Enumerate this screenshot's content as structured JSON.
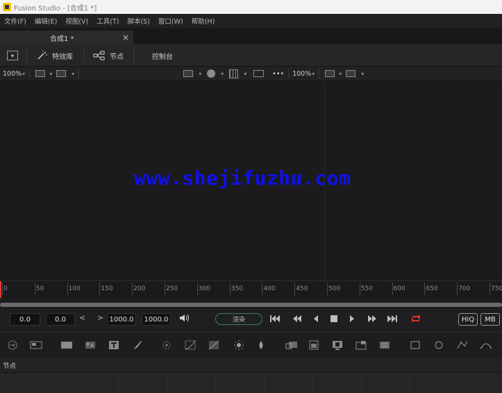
{
  "window": {
    "title": "Fusion Studio - [合成1 *]"
  },
  "menu": [
    "文件(F)",
    "编辑(E)",
    "视图(V)",
    "工具(T)",
    "脚本(S)",
    "窗口(W)",
    "帮助(H)"
  ],
  "tab": {
    "label": "合成1 *",
    "close": "×"
  },
  "toolbar": {
    "effects_label": "特效库",
    "nodes_label": "节点",
    "console_label": "控制台"
  },
  "viewer_bar": {
    "left_zoom": "100%",
    "right_zoom": "100%",
    "dots": "•••"
  },
  "watermark": "www.shejifuzhu.com",
  "ruler": {
    "ticks": [
      "0",
      "50",
      "100",
      "150",
      "200",
      "250",
      "300",
      "350",
      "400",
      "450",
      "500",
      "550",
      "600",
      "650",
      "700",
      "750"
    ]
  },
  "transport": {
    "field1": "0.0",
    "field2": "0.0",
    "prev": "<",
    "next": ">",
    "field3": "1000.0",
    "field4": "1000.0",
    "render_label": "渲染",
    "hiq": "HiQ",
    "mb": "MB",
    "loop_color": "#e0302a"
  },
  "nodes_panel": {
    "title": "节点"
  },
  "colors": {
    "accent_green": "#3a7e5b",
    "playhead": "#e23b2e",
    "watermark": "#1010ee"
  }
}
